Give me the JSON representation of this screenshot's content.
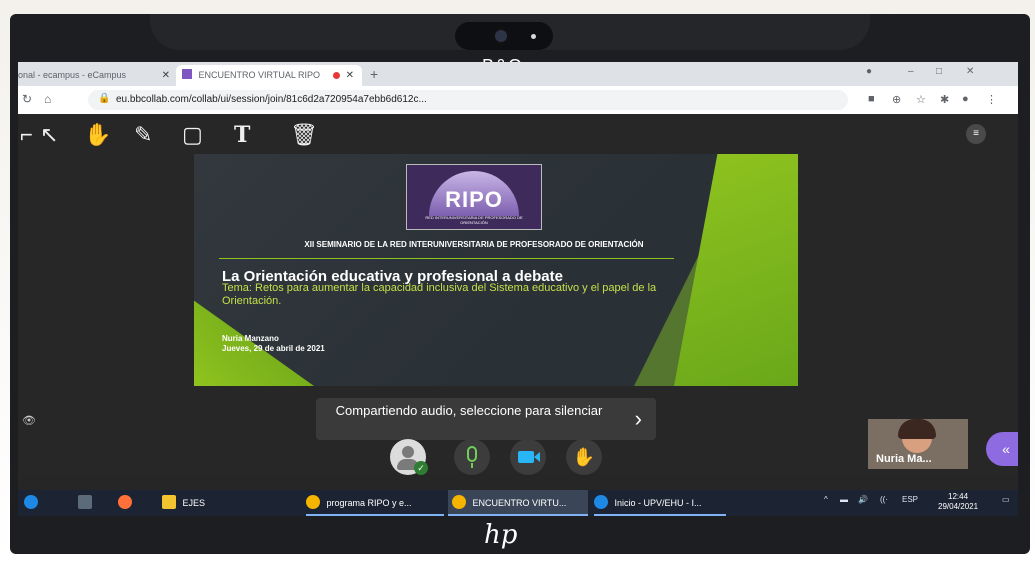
{
  "laptop": {
    "brand_top": "B&O",
    "brand_bottom": "hp"
  },
  "browser": {
    "tabs": [
      {
        "label": "onal - ecampus - eCampus"
      },
      {
        "label": "ENCUENTRO VIRTUAL RIPO"
      }
    ],
    "url": "eu.bbcollab.com/collab/ui/session/join/81c6d2a720954a7ebb6d612c..."
  },
  "slide": {
    "logo_text": "RIPO",
    "logo_subtext": "RED INTERUNIVERSITARIA DE PROFESORADO DE ORIENTACIÓN",
    "heading": "XII SEMINARIO DE LA RED INTERUNIVERSITARIA DE PROFESORADO DE ORIENTACIÓN",
    "title": "La Orientación educativa y profesional a debate",
    "topic": "Tema: Retos para aumentar la capacidad inclusiva del Sistema educativo y el papel de la Orientación.",
    "author": "Nuria Manzano",
    "date": "Jueves, 29 de abril de 2021"
  },
  "share_notice": {
    "text": "Compartiendo audio, seleccione para silenciar"
  },
  "participant": {
    "name": "Nuria Ma..."
  },
  "taskbar": {
    "items": [
      {
        "label": "EJES"
      },
      {
        "label": "programa RIPO y e..."
      },
      {
        "label": "ENCUENTRO VIRTU..."
      },
      {
        "label": "Inicio - UPV/EHU - I..."
      }
    ],
    "language": "ESP",
    "time": "12:44",
    "date": "29/04/2021"
  },
  "colors": {
    "accent_green": "#8fc31f",
    "collab_purple": "#8e6be0",
    "taskbar": "#1c2433"
  }
}
